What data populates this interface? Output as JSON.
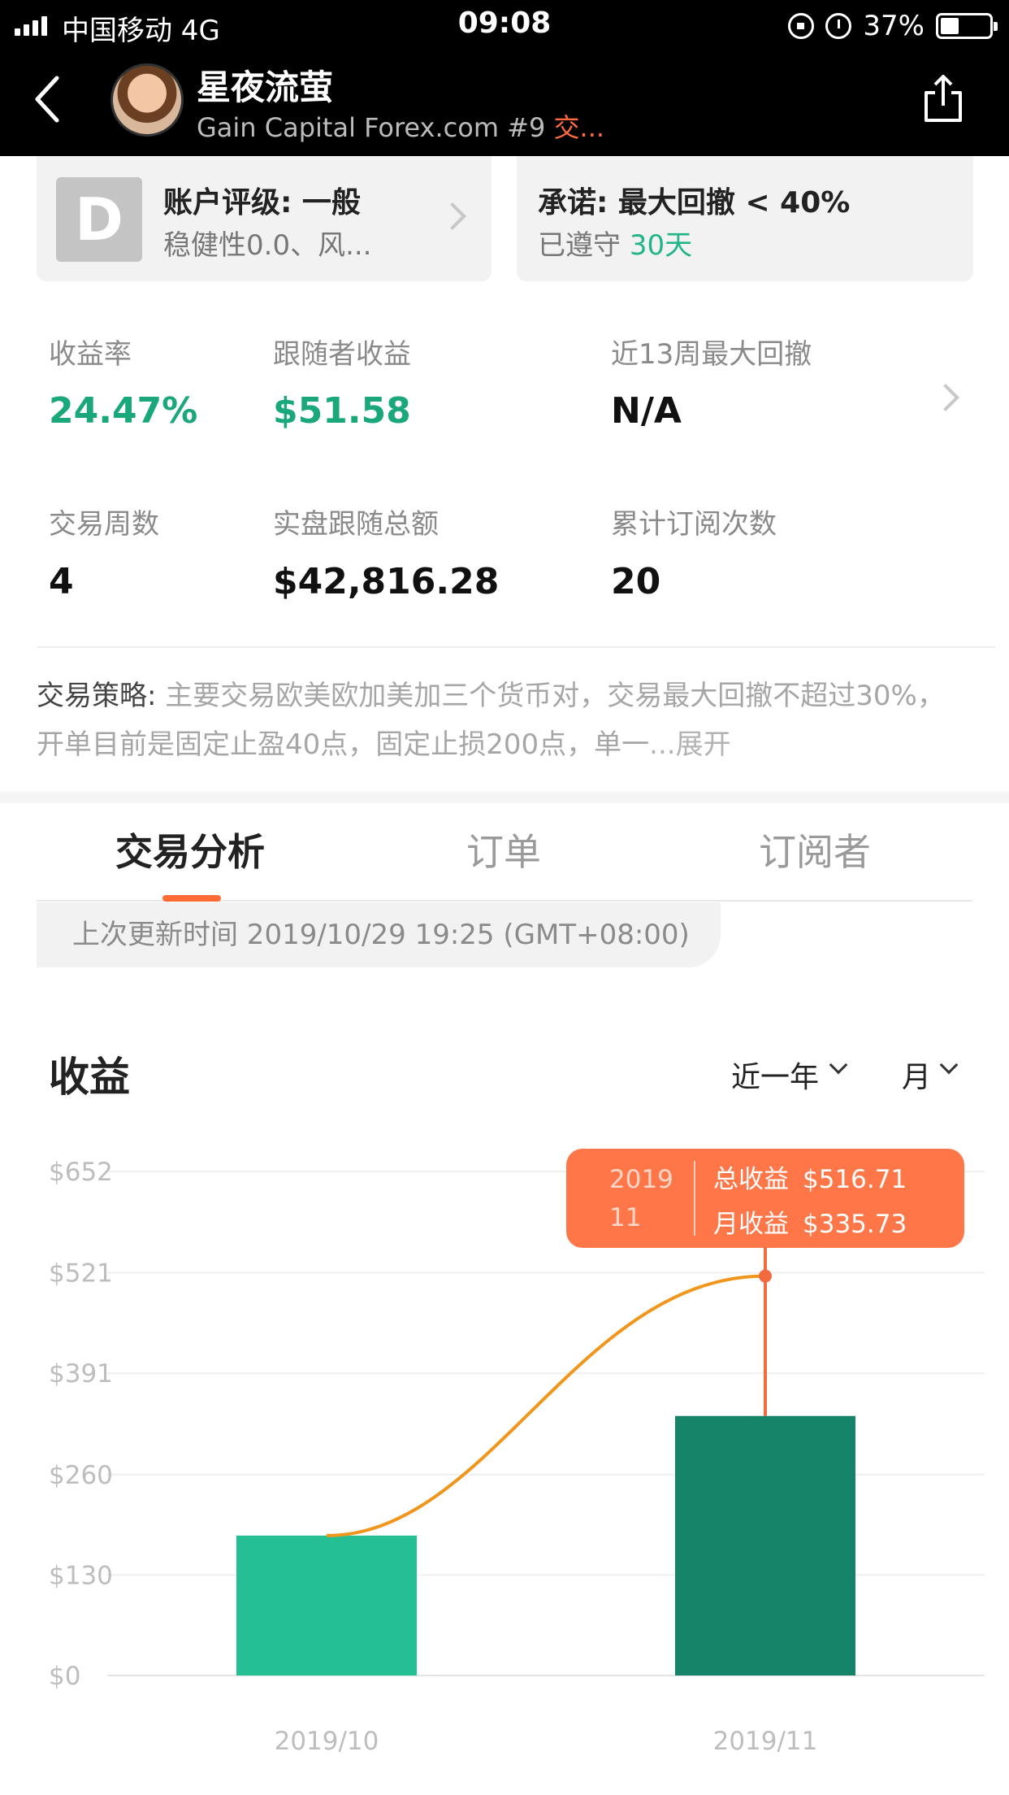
{
  "status_bar": {
    "carrier": "中国移动  4G",
    "time": "09:08",
    "battery": "37%"
  },
  "header": {
    "name": "星夜流萤",
    "subtitle_broker": "Gain Capital Forex.com #9 ",
    "subtitle_more": "交...",
    "icons": [
      "back-chevron-icon",
      "avatar",
      "share-icon"
    ]
  },
  "rating_card": {
    "grade": "D",
    "title": "账户评级: 一般",
    "subtitle": "稳健性0.0、风..."
  },
  "promise_card": {
    "title": "承诺: 最大回撤 < 40%",
    "kept_prefix": "已遵守 ",
    "kept_days": "30天"
  },
  "stats": [
    {
      "label": "收益率",
      "value": "24.47%"
    },
    {
      "label": "跟随者收益",
      "value": "$51.58"
    },
    {
      "label": "近13周最大回撤",
      "value": "N/A"
    },
    {
      "label": "交易周数",
      "value": "4"
    },
    {
      "label": "实盘跟随总额",
      "value": "$42,816.28"
    },
    {
      "label": "累计订阅次数",
      "value": "20"
    }
  ],
  "strategy": {
    "label": "交易策略:",
    "text": " 主要交易欧美欧加美加三个货币对，交易最大回撤不超过30%，开单目前是固定止盈40点，固定止损200点，单一",
    "more": "...展开"
  },
  "tabs": [
    {
      "label": "交易分析",
      "active": true
    },
    {
      "label": "订单",
      "active": false
    },
    {
      "label": "订阅者",
      "active": false
    }
  ],
  "last_update": "上次更新时间 2019/10/29 19:25 (GMT+08:00)",
  "chart_header": {
    "title": "收益",
    "range": "近一年",
    "period": "月"
  },
  "tooltip": {
    "date_line1": "2019",
    "date_line2": "11",
    "total_label": "总收益",
    "total_value": "$516.71",
    "monthly_label": "月收益",
    "monthly_value": "$335.73"
  },
  "chart_data": {
    "type": "bar",
    "categories": [
      "2019/10",
      "2019/11"
    ],
    "series": [
      {
        "type": "bar",
        "values": [
          180.98,
          335.73
        ]
      },
      {
        "type": "line",
        "values": [
          180.98,
          516.71
        ]
      }
    ],
    "ylim": [
      0,
      652
    ],
    "yticks": [
      "$652",
      "$521",
      "$391",
      "$260",
      "$130",
      "$0"
    ],
    "ytick_values": [
      652,
      521,
      391,
      260,
      130,
      0
    ],
    "grid": true,
    "colors": {
      "bar_1": "#24bf92",
      "bar_2": "#168469",
      "line": "#f0961c",
      "highlight": "#f26b3e",
      "tooltip": "#ff7748"
    }
  }
}
